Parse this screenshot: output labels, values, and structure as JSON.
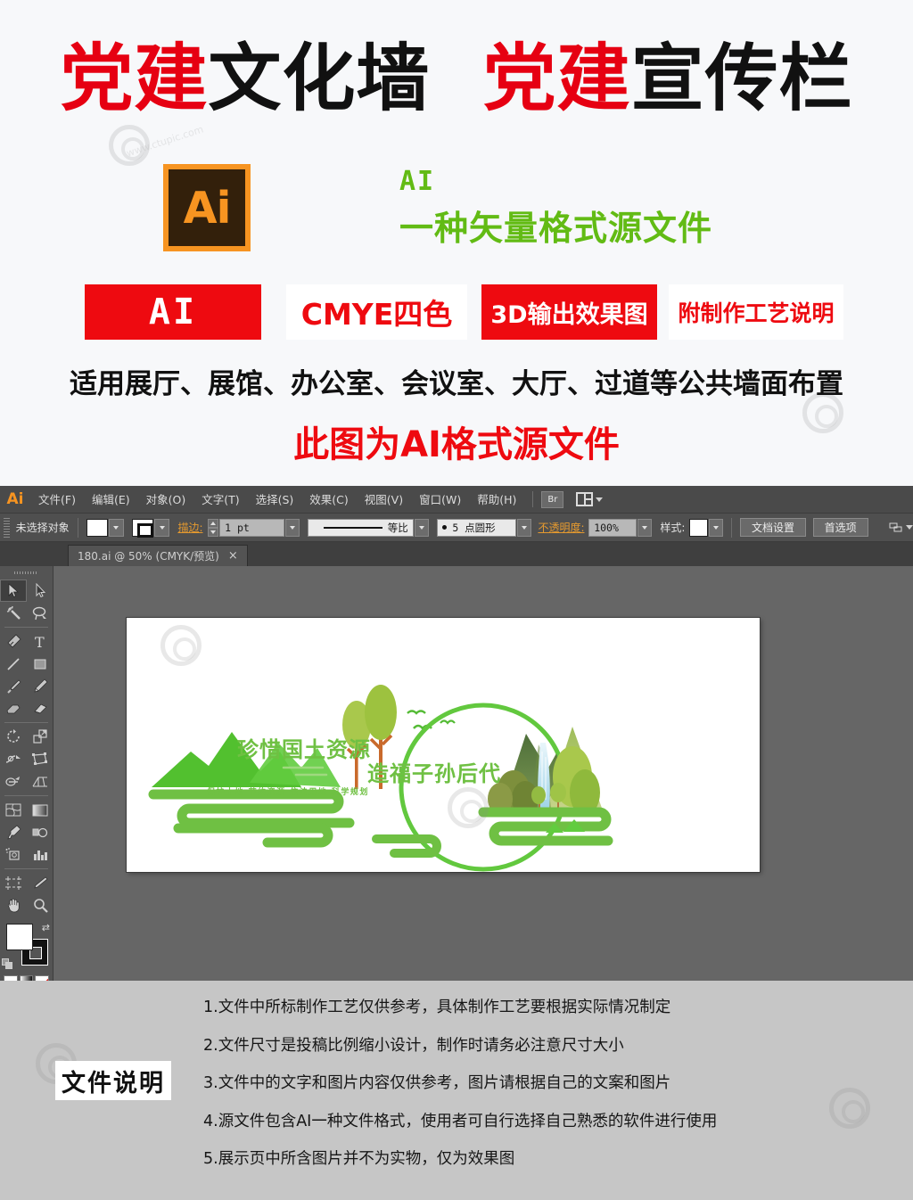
{
  "promo": {
    "title_parts": [
      {
        "text": "党建",
        "color": "red"
      },
      {
        "text": "文化墙",
        "color": "black"
      },
      {
        "text": " ",
        "color": "black"
      },
      {
        "text": "党建",
        "color": "red"
      },
      {
        "text": "宣传栏",
        "color": "black"
      }
    ],
    "title_full": "党建文化墙 党建宣传栏",
    "ai_logo_label": "Ai",
    "ai_desc_line1": "AI",
    "ai_desc_line2": "一种矢量格式源文件",
    "badges": [
      {
        "label": "AI",
        "bg": "#ee0a10",
        "fg": "#ffffff"
      },
      {
        "label": "CMYE四色",
        "bg": "#ffffff",
        "fg": "#ee0a10"
      },
      {
        "label": "3D输出效果图",
        "bg": "#ee0a10",
        "fg": "#ffffff"
      },
      {
        "label": "附制作工艺说明",
        "bg": "#ffffff",
        "fg": "#ee0a10"
      }
    ],
    "usage_line": "适用展厅、展馆、办公室、会议室、大厅、过道等公共墙面布置",
    "format_line": "此图为AI格式源文件",
    "watermark": "www.ctupic.com"
  },
  "app": {
    "logo": "Ai",
    "menus": [
      {
        "label": "文件(F)"
      },
      {
        "label": "编辑(E)"
      },
      {
        "label": "对象(O)"
      },
      {
        "label": "文字(T)"
      },
      {
        "label": "选择(S)"
      },
      {
        "label": "效果(C)"
      },
      {
        "label": "视图(V)"
      },
      {
        "label": "窗口(W)"
      },
      {
        "label": "帮助(H)"
      }
    ],
    "bridge_label": "Br",
    "control": {
      "selection_status": "未选择对象",
      "stroke_label": "描边:",
      "stroke_weight": "1 pt",
      "stroke_profile": "等比",
      "brush_def": "5 点圆形",
      "opacity_label": "不透明度:",
      "opacity_value": "100%",
      "style_label": "样式:",
      "doc_setup_button": "文档设置",
      "preferences_button": "首选项"
    },
    "document_tab": {
      "title": "180.ai @ 50% (CMYK/预览)",
      "close": "×"
    },
    "tools": [
      {
        "name": "selection-tool",
        "active": true
      },
      {
        "name": "direct-selection-tool",
        "active": false
      },
      {
        "name": "magic-wand-tool",
        "active": false
      },
      {
        "name": "lasso-tool",
        "active": false
      },
      {
        "name": "pen-tool",
        "active": false
      },
      {
        "name": "type-tool",
        "active": false
      },
      {
        "name": "line-segment-tool",
        "active": false
      },
      {
        "name": "rectangle-tool",
        "active": false
      },
      {
        "name": "paintbrush-tool",
        "active": false
      },
      {
        "name": "pencil-tool",
        "active": false
      },
      {
        "name": "blob-brush-tool",
        "active": false
      },
      {
        "name": "eraser-tool",
        "active": false
      },
      {
        "name": "rotate-tool",
        "active": false
      },
      {
        "name": "scale-tool",
        "active": false
      },
      {
        "name": "width-tool",
        "active": false
      },
      {
        "name": "free-transform-tool",
        "active": false
      },
      {
        "name": "shape-builder-tool",
        "active": false
      },
      {
        "name": "perspective-grid-tool",
        "active": false
      },
      {
        "name": "mesh-tool",
        "active": false
      },
      {
        "name": "gradient-tool",
        "active": false
      },
      {
        "name": "eyedropper-tool",
        "active": false
      },
      {
        "name": "blend-tool",
        "active": false
      },
      {
        "name": "symbol-sprayer-tool",
        "active": false
      },
      {
        "name": "column-graph-tool",
        "active": false
      },
      {
        "name": "artboard-tool",
        "active": false
      },
      {
        "name": "slice-tool",
        "active": false
      },
      {
        "name": "hand-tool",
        "active": false
      },
      {
        "name": "zoom-tool",
        "active": false
      }
    ],
    "color_modes": [
      "color-fill",
      "gradient-fill",
      "none-fill"
    ],
    "colors": {
      "menubar_bg": "#4a4a4a",
      "controlbar_bg": "#4f4f4f",
      "toolbox_bg": "#545454",
      "canvas_bg": "#666666",
      "accent_orange": "#e59a2f"
    }
  },
  "artwork": {
    "headline_1": "珍惜国土资源",
    "headline_2": "造福子孙后代",
    "subline": "保护土地 节约资源 依法用地 科学规划",
    "green": "#6fc043"
  },
  "notes": {
    "badge": "文件说明",
    "items": [
      "1.文件中所标制作工艺仅供参考，具体制作工艺要根据实际情况制定",
      "2.文件尺寸是投稿比例缩小设计，制作时请务必注意尺寸大小",
      "3.文件中的文字和图片内容仅供参考，图片请根据自己的文案和图片",
      "4.源文件包含AI一种文件格式，使用者可自行选择自己熟悉的软件进行使用",
      "5.展示页中所含图片并不为实物，仅为效果图"
    ]
  }
}
